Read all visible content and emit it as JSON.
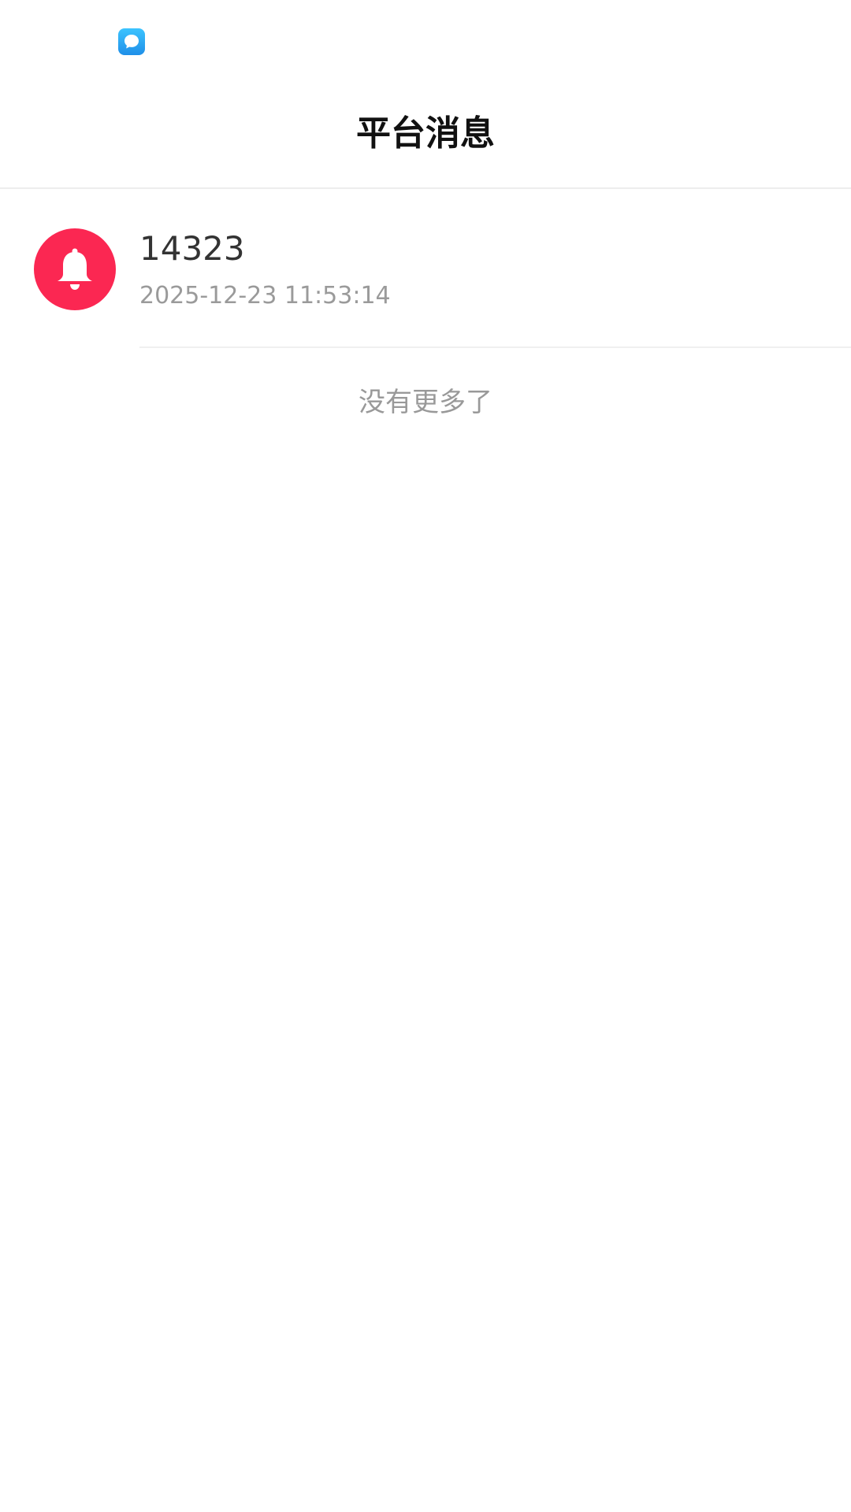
{
  "status_bar": {
    "app_icon": "chat-bubble-icon",
    "accent": "#1f8fe8"
  },
  "header": {
    "title": "平台消息"
  },
  "messages": [
    {
      "title": "14323",
      "time": "2025-12-23 11:53:14",
      "icon": "bell-icon",
      "icon_bg": "#fb2752"
    }
  ],
  "footer": {
    "no_more_text": "没有更多了"
  }
}
